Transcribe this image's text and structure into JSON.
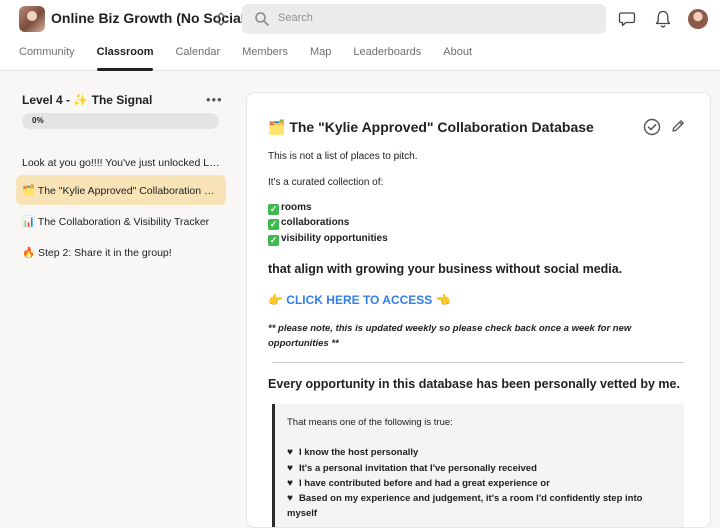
{
  "header": {
    "group_name": "Online Biz Growth (No Social)",
    "search_placeholder": "Search"
  },
  "tabs": [
    {
      "label": "Community"
    },
    {
      "label": "Classroom",
      "active": true
    },
    {
      "label": "Calendar"
    },
    {
      "label": "Members"
    },
    {
      "label": "Map"
    },
    {
      "label": "Leaderboards"
    },
    {
      "label": "About"
    }
  ],
  "sidebar": {
    "level_title": "Level 4 - ✨ The Signal",
    "progress_text": "0%",
    "progress_value": 0,
    "lessons": [
      {
        "label": "Look at you go!!!! You've just unlocked Lev..."
      },
      {
        "label": "🗂️ The \"Kylie Approved\" Collaboration Dat...",
        "active": true
      },
      {
        "label": "📊 The Collaboration & Visibility Tracker"
      },
      {
        "label": "🔥 Step 2: Share it in the group!"
      }
    ]
  },
  "content": {
    "title": "🗂️ The \"Kylie Approved\" Collaboration Database",
    "intro1": "This is not a list of places to pitch.",
    "intro2": "It's a curated collection of:",
    "checks": [
      "rooms",
      "collaborations",
      "visibility opportunities"
    ],
    "align_line": "that align with growing your business without social media.",
    "cta": "👉 CLICK HERE TO ACCESS 👈",
    "note": "** please note, this is updated weekly so please check back once a week for new opportunities **",
    "vetted_heading": "Every opportunity in this database has been personally vetted by me.",
    "quote_intro": "That means one of the following is true:",
    "quote_items": [
      "I know the host personally",
      "It's a personal invitation that I've personally received",
      "I have contributed before and had a great experience or",
      "Based on my experience and judgement, it's a room I'd confidently step into myself"
    ]
  },
  "colors": {
    "accent_link": "#2f80ed",
    "active_lesson_bg": "#f7e3b5",
    "check_green": "#3fb950"
  }
}
